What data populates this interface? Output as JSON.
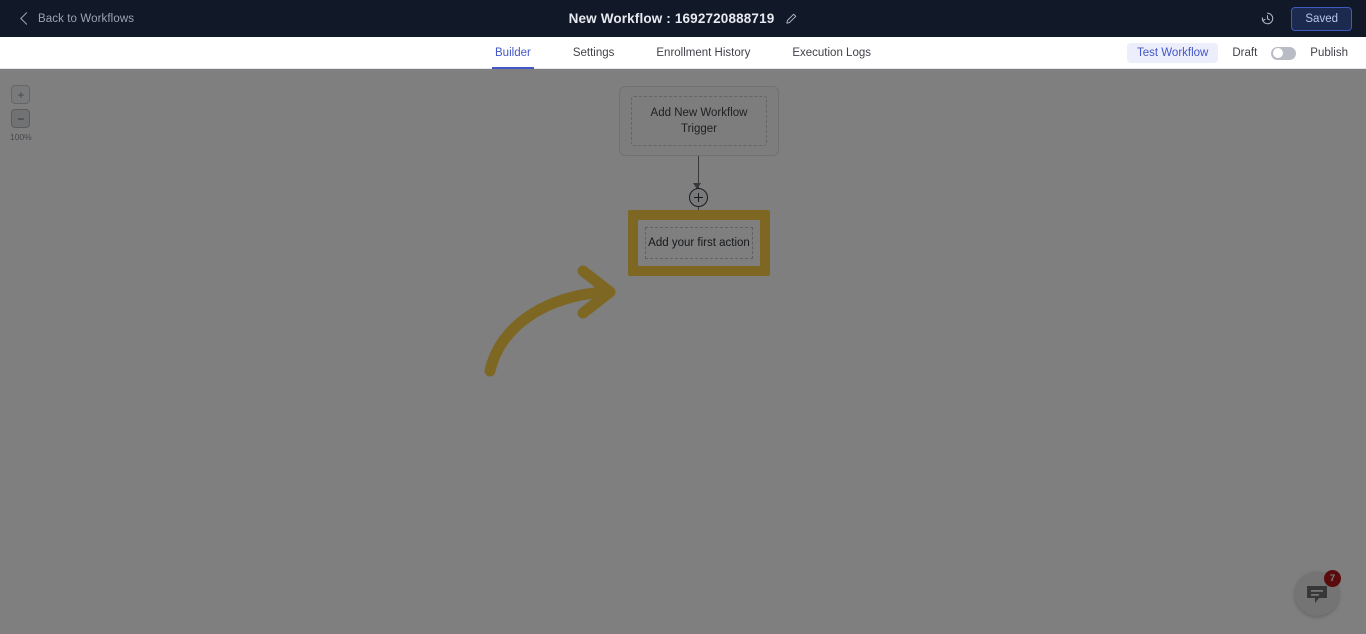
{
  "header": {
    "back_label": "Back to Workflows",
    "back_icon": "chevron-left-icon",
    "title": "New Workflow : 1692720888719",
    "edit_icon": "pencil-icon",
    "history_icon": "clock-history-icon",
    "saved_label": "Saved"
  },
  "nav": {
    "tabs": [
      {
        "label": "Builder",
        "active": true
      },
      {
        "label": "Settings",
        "active": false
      },
      {
        "label": "Enrollment History",
        "active": false
      },
      {
        "label": "Execution Logs",
        "active": false
      }
    ],
    "test_workflow_label": "Test Workflow",
    "draft_label": "Draft",
    "publish_label": "Publish",
    "toggle_state": "off"
  },
  "canvas": {
    "zoom": {
      "plus_label": "+",
      "minus_label": "−",
      "level": "100%"
    },
    "trigger_node": {
      "label": "Add New Workflow Trigger",
      "label_line1": "Add New Workflow",
      "label_line2": "Trigger"
    },
    "add_step_icon": "plus-circle-icon",
    "action_node": {
      "label": "Add your first action",
      "highlight_color": "#fbcf47"
    },
    "annotation": {
      "type": "curved-arrow",
      "color": "#fbcf47",
      "direction": "left-to-right-up"
    }
  },
  "chat": {
    "icon": "chat-bubble-icon",
    "unread_count": "7",
    "badge_color": "#b4161b"
  },
  "colors": {
    "header_bg": "#111827",
    "accent_blue": "#4457c7",
    "highlight_yellow": "#fbcf47",
    "overlay": "rgba(0,0,0,0.5)"
  }
}
